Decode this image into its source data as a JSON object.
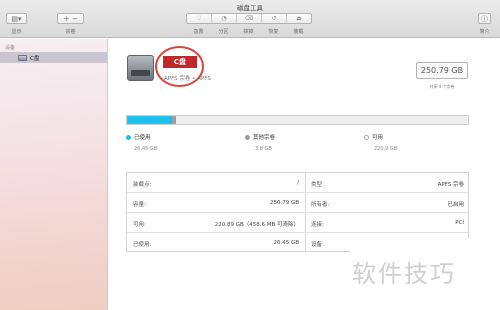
{
  "window": {
    "title": "磁盘工具"
  },
  "toolbar": {
    "view_label": "显示",
    "volume_label": "宗卷",
    "first_aid_label": "急救",
    "partition_label": "分区",
    "erase_label": "抹掉",
    "restore_label": "恢复",
    "mount_label": "装载",
    "info_label": "简介"
  },
  "sidebar": {
    "section": "设备",
    "items": [
      {
        "label": "C盘"
      }
    ]
  },
  "volume": {
    "name": "C盘",
    "description": "APFS 宗卷 • APFS",
    "capacity": "250.79 GB",
    "capacity_sub": "共享 4 个宗卷"
  },
  "usage": {
    "used_fraction": 0.132,
    "other_fraction": 0.012,
    "colors": {
      "used": "#1ec0f0",
      "other": "#9f9f9f",
      "free": "#ededed"
    },
    "legend": [
      {
        "label": "已使用",
        "value": "26.45 GB",
        "color": "#1ec0f0"
      },
      {
        "label": "其他宗卷",
        "value": "3.8 GB",
        "color": "#9a9a9a"
      },
      {
        "label": "可用",
        "value": "220.9 GB",
        "color": "#ffffff"
      }
    ]
  },
  "info": {
    "left": [
      {
        "key": "装载点:",
        "value": "/"
      },
      {
        "key": "容量:",
        "value": "250.79 GB"
      },
      {
        "key": "可用:",
        "value": "220.89 GB（458.6 MB 可清除）"
      },
      {
        "key": "已使用:",
        "value": "26.45 GB"
      }
    ],
    "right": [
      {
        "key": "类型:",
        "value": "APFS 宗卷"
      },
      {
        "key": "所有者:",
        "value": "已启用"
      },
      {
        "key": "连接:",
        "value": "PCI"
      },
      {
        "key": "设备:",
        "value": ""
      }
    ]
  },
  "watermark": "软件技巧"
}
